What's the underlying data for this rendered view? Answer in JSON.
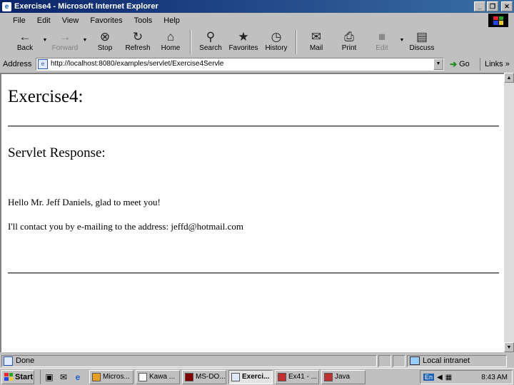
{
  "window": {
    "title": "Exercise4 - Microsoft Internet Explorer",
    "min_glyph": "_",
    "max_glyph": "❐",
    "close_glyph": "✕"
  },
  "menu": {
    "items": [
      {
        "label": "File"
      },
      {
        "label": "Edit"
      },
      {
        "label": "View"
      },
      {
        "label": "Favorites"
      },
      {
        "label": "Tools"
      },
      {
        "label": "Help"
      }
    ]
  },
  "toolbar": {
    "back": {
      "label": "Back",
      "icon": "←"
    },
    "forward": {
      "label": "Forward",
      "icon": "→"
    },
    "stop": {
      "label": "Stop",
      "icon": "⊗"
    },
    "refresh": {
      "label": "Refresh",
      "icon": "↻"
    },
    "home": {
      "label": "Home",
      "icon": "⌂"
    },
    "search": {
      "label": "Search",
      "icon": "⚲"
    },
    "favorites": {
      "label": "Favorites",
      "icon": "★"
    },
    "history": {
      "label": "History",
      "icon": "◷"
    },
    "mail": {
      "label": "Mail",
      "icon": "✉"
    },
    "print": {
      "label": "Print",
      "icon": "⎙"
    },
    "edit": {
      "label": "Edit",
      "icon": "■"
    },
    "discuss": {
      "label": "Discuss",
      "icon": "▤"
    }
  },
  "address": {
    "label": "Address",
    "url": "http://localhost:8080/examples/servlet/Exercise4Servle",
    "go_label": "Go",
    "links_label": "Links »"
  },
  "page": {
    "heading": "Exercise4:",
    "subheading": "Servlet Response:",
    "line1": "Hello  Mr. Jeff Daniels, glad to meet you!",
    "line2": "I'll contact you by e-mailing to the address:  jeffd@hotmail.com"
  },
  "status": {
    "text": "Done",
    "zone": "Local intranet"
  },
  "taskbar": {
    "start_label": "Start",
    "tasks": [
      {
        "label": "Micros..."
      },
      {
        "label": "Kawa ..."
      },
      {
        "label": "MS-DO..."
      },
      {
        "label": "Exerci..."
      },
      {
        "label": "Ex41 - ..."
      },
      {
        "label": "Java"
      }
    ],
    "tray_lang": "En",
    "clock": "8:43 AM"
  }
}
